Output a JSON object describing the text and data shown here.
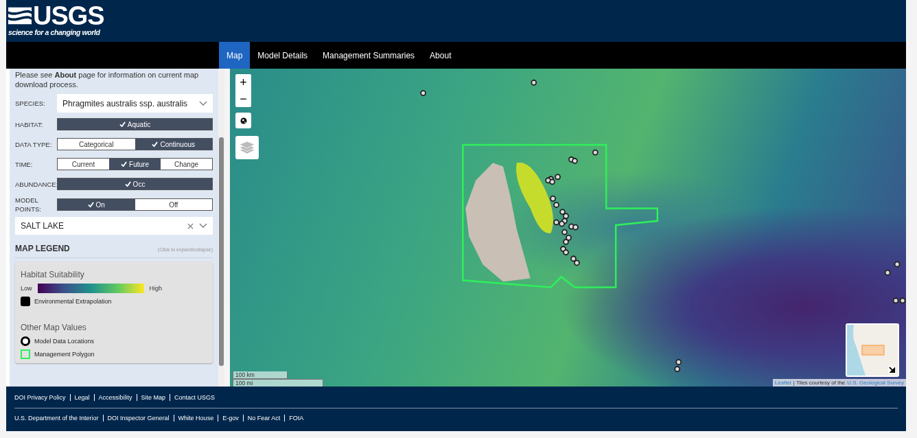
{
  "header": {
    "logo": "USGS",
    "tagline": "science for a changing world"
  },
  "nav": [
    {
      "label": "Map",
      "selected": true
    },
    {
      "label": "Model Details",
      "selected": false
    },
    {
      "label": "Management Summaries",
      "selected": false
    },
    {
      "label": "About",
      "selected": false
    }
  ],
  "sidebar": {
    "intro": "Please see **About** page for information on current map download process.",
    "species": {
      "label": "SPECIES:",
      "value": "Phragmites australis ssp. australis"
    },
    "toggles": [
      {
        "label": "HABITAT:",
        "options": [
          {
            "label": "Aquatic",
            "selected": true
          }
        ]
      },
      {
        "label": "DATA TYPE:",
        "options": [
          {
            "label": "Categorical",
            "selected": false
          },
          {
            "label": "Continuous",
            "selected": true
          }
        ]
      },
      {
        "label": "TIME:",
        "options": [
          {
            "label": "Current",
            "selected": false
          },
          {
            "label": "Future",
            "selected": true
          },
          {
            "label": "Change",
            "selected": false
          }
        ]
      },
      {
        "label": "ABUNDANCE:",
        "options": [
          {
            "label": "Occ",
            "selected": true
          }
        ]
      },
      {
        "label": "MODEL POINTS:",
        "options": [
          {
            "label": "On",
            "selected": true
          },
          {
            "label": "Off",
            "selected": false
          }
        ]
      }
    ],
    "location": {
      "value": "SALT LAKE"
    },
    "legend": {
      "title": "MAP LEGEND",
      "hint": "(Click to expand/collapse)",
      "suitability_title": "Habitat Suitability",
      "low": "Low",
      "high": "High",
      "items": [
        {
          "kind": "swatch",
          "label": "Environmental Extrapolation"
        }
      ],
      "other_title": "Other Map Values",
      "other_items": [
        {
          "kind": "circle",
          "label": "Model Data Locations"
        },
        {
          "kind": "polygon",
          "label": "Management Polygon"
        }
      ]
    }
  },
  "map": {
    "zoom_in": "+",
    "zoom_out": "−",
    "scale": [
      "100 km",
      "100 mi"
    ],
    "attribution": {
      "link": "Leaflet",
      "text": "| Tiles courtesy of the",
      "source_link": "U.S. Geological Survey"
    }
  },
  "footer": {
    "site_links": [
      "DOI Privacy Policy",
      "Legal",
      "Accessibility",
      "Site Map",
      "Contact USGS"
    ],
    "government_links": [
      "U.S. Department of the Interior",
      "DOI Inspector General",
      "White House",
      "E-gov",
      "No Fear Act",
      "FOIA"
    ]
  }
}
